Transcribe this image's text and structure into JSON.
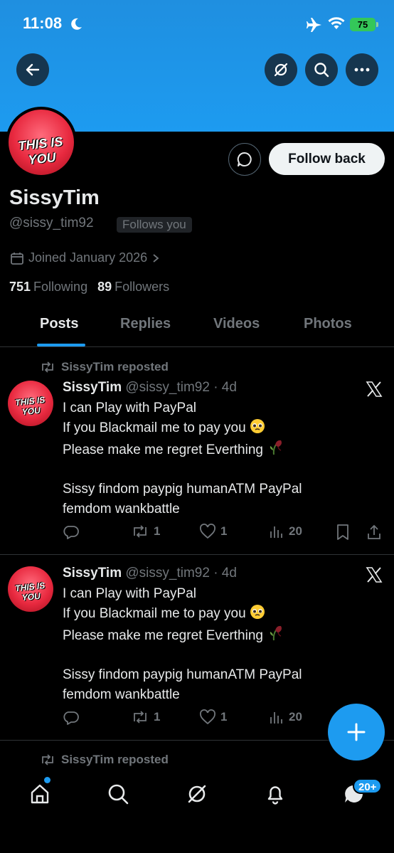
{
  "status_bar": {
    "time": "11:08",
    "battery": "75"
  },
  "header": {
    "back_icon": "arrow-left-icon",
    "grok_icon": "grok-icon",
    "search_icon": "search-icon",
    "more_icon": "more-icon",
    "banner_color": "#1d9bf0"
  },
  "profile": {
    "avatar_text": "THIS IS YOU",
    "display_name": "SissyTim",
    "handle": "@sissy_tim92",
    "follows_you": "Follows you",
    "follow_button": "Follow back",
    "joined": "Joined January 2026",
    "following_count": "751",
    "following_label": "Following",
    "followers_count": "89",
    "followers_label": "Followers"
  },
  "tabs": [
    {
      "label": "Posts",
      "active": true
    },
    {
      "label": "Replies",
      "active": false
    },
    {
      "label": "Videos",
      "active": false
    },
    {
      "label": "Photos",
      "active": false
    }
  ],
  "posts": [
    {
      "repost_label": "SissyTim reposted",
      "avatar_text": "THIS IS YOU",
      "name": "SissyTim",
      "handle": "@sissy_tim92",
      "time": "· 4d",
      "lines": [
        "I can Play with PayPal",
        "If you Blackmail me to pay you",
        "Please make me regret Everthing",
        "",
        "Sissy findom paypig humanATM PayPal",
        "femdom wankbattle"
      ],
      "replies": "",
      "reposts": "1",
      "likes": "1",
      "views": "20"
    },
    {
      "repost_label": "",
      "avatar_text": "THIS IS YOU",
      "name": "SissyTim",
      "handle": "@sissy_tim92",
      "time": "· 4d",
      "lines": [
        "I can Play with PayPal",
        "If you Blackmail me to pay you",
        "Please make me regret Everthing",
        "",
        "Sissy findom paypig humanATM PayPal",
        "femdom wankbattle"
      ],
      "replies": "",
      "reposts": "1",
      "likes": "1",
      "views": "20"
    }
  ],
  "next_repost_label": "SissyTim reposted",
  "bottom_nav": {
    "items": [
      "home-icon",
      "search-icon",
      "grok-icon",
      "notifications-icon",
      "messages-icon"
    ],
    "messages_badge": "20+"
  },
  "accent_color": "#1d9bf0"
}
